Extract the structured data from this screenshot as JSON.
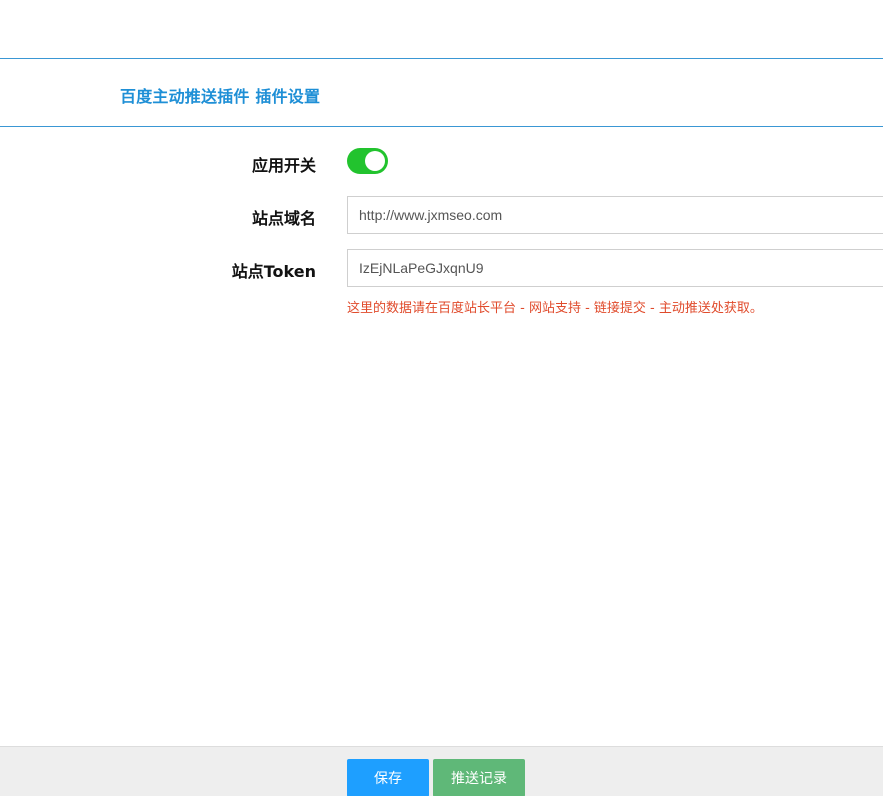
{
  "header": {
    "title": "百度主动推送插件 插件设置"
  },
  "form": {
    "switch": {
      "label": "应用开关",
      "on": true
    },
    "domain": {
      "label": "站点域名",
      "value": "http://www.jxmseo.com"
    },
    "token": {
      "label": "站点Token",
      "value": "IzEjNLaPeGJxqnU9",
      "hint": "这里的数据请在百度站长平台 - 网站支持 - 链接提交 - 主动推送处获取。"
    }
  },
  "footer": {
    "save_label": "保存",
    "log_label": "推送记录"
  },
  "colors": {
    "accent": "#1e8fd6",
    "toggle_on": "#22c32e",
    "hint": "#e04b2c",
    "save_button": "#1e9fff",
    "log_button": "#5fb878"
  }
}
